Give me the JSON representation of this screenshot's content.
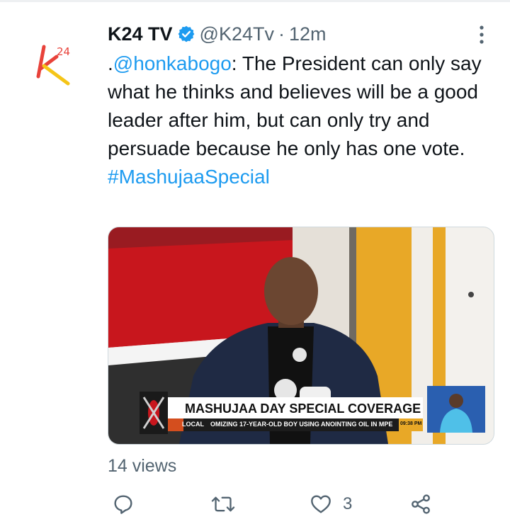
{
  "tweet": {
    "display_name": "K24 TV",
    "handle": "@K24Tv",
    "separator": "·",
    "time": "12m",
    "text_prefix": ".",
    "mention": "@honkabogo",
    "text_body": ": The President can only say what he thinks and believes will be a good leader after him, but can only try and persuade because he only has one vote.",
    "hashtag": "#MashujaaSpecial",
    "views": "14 views"
  },
  "media": {
    "banner_title": "MASHUJAA DAY SPECIAL COVERAGE",
    "ticker_tag": "LOCAL",
    "ticker_text": "OMIZING 17-YEAR-OLD BOY USING ANOINTING OIL IN MPE",
    "ticker_time": "09:38 PM"
  },
  "actions": {
    "reply_count": "",
    "retweet_count": "",
    "like_count": "3"
  },
  "icons": {
    "avatar": "k24-logo-icon",
    "verified": "verified-badge-icon",
    "more": "more-icon",
    "reply": "reply-icon",
    "retweet": "retweet-icon",
    "like": "heart-icon",
    "share": "share-icon"
  },
  "colors": {
    "link": "#1d9bf0",
    "secondary_text": "#536471",
    "logo_orange": "#f39c12",
    "logo_red": "#e03a2f"
  }
}
